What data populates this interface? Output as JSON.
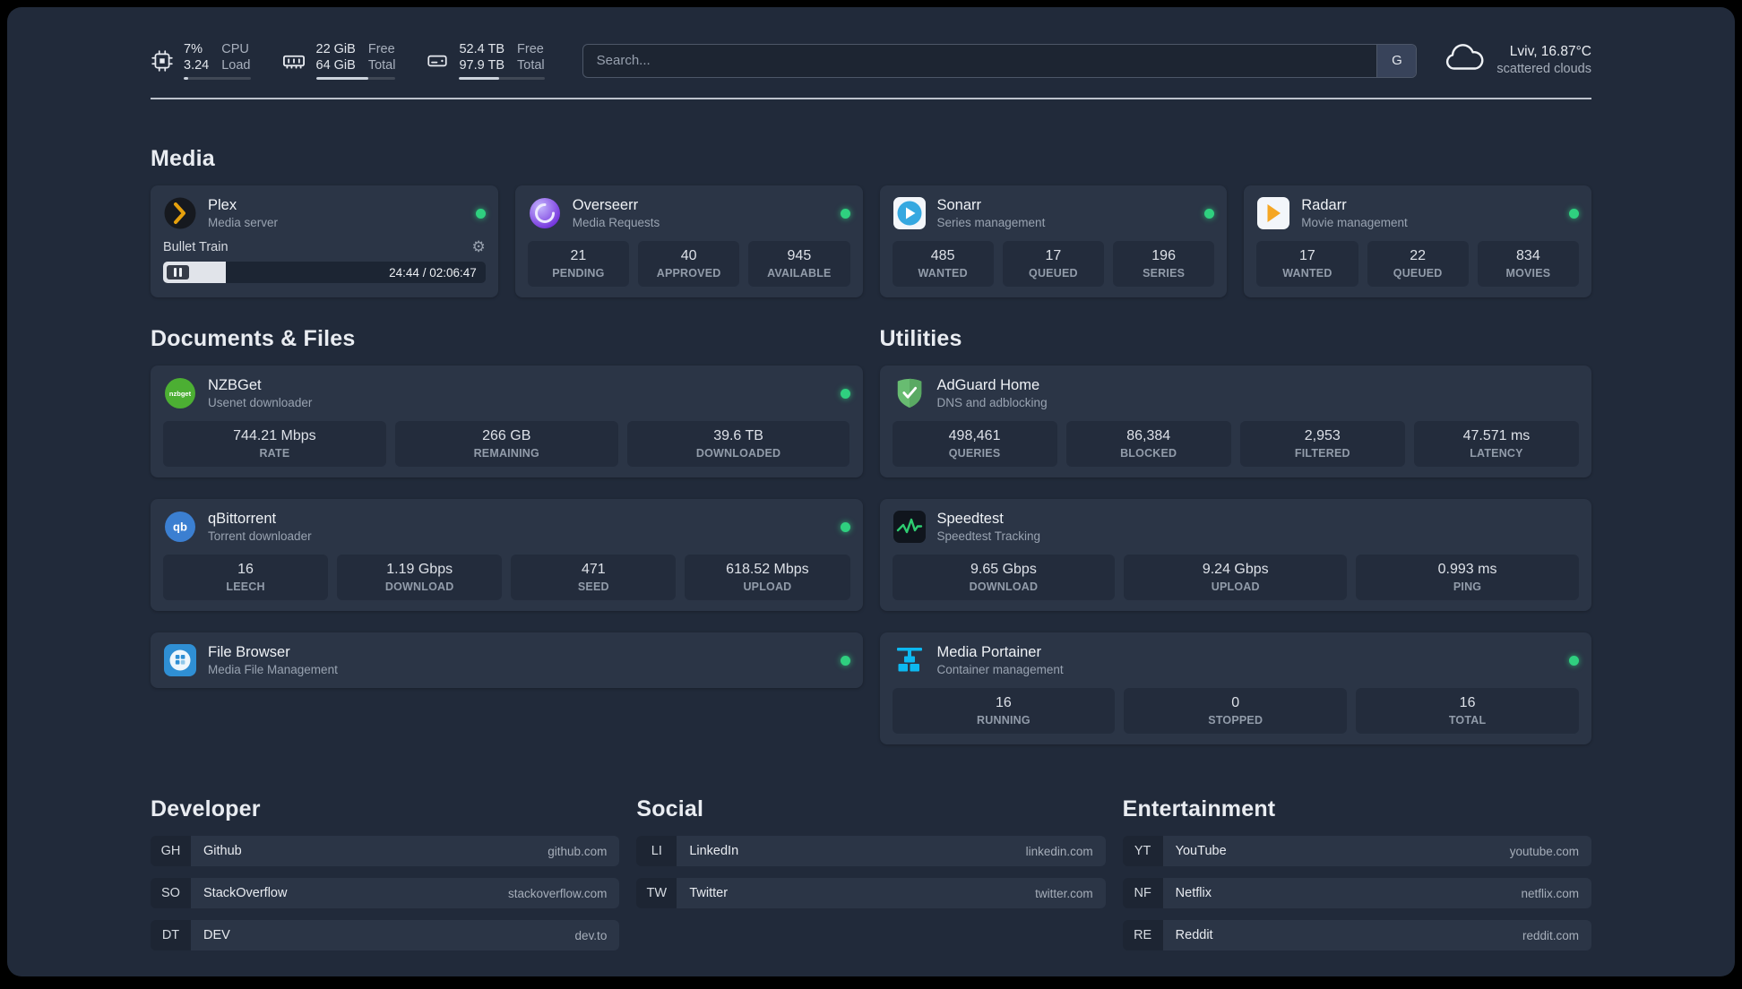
{
  "colors": {
    "status_online": "#2fd07f",
    "plex_accent": "#e5a00d",
    "overseerr_purple": "#6d28d9",
    "sonarr_blue": "#35a8e0",
    "radarr_amber": "#f5a623",
    "nzbget_green": "#4caf33",
    "qbittorrent_blue": "#3b7fd1",
    "adguard_green": "#68bc71",
    "speedtest_green": "#2ecc71",
    "portainer_blue": "#0db8f0"
  },
  "topbar": {
    "resources": [
      {
        "icon": "cpu-icon",
        "v1": "7%",
        "l1": "CPU",
        "v2": "3.24",
        "l2": "Load",
        "percent": 7
      },
      {
        "icon": "memory-icon",
        "v1": "22 GiB",
        "l1": "Free",
        "v2": "64 GiB",
        "l2": "Total",
        "percent": 66
      },
      {
        "icon": "disk-icon",
        "v1": "52.4 TB",
        "l1": "Free",
        "v2": "97.9 TB",
        "l2": "Total",
        "percent": 47
      }
    ],
    "search": {
      "placeholder": "Search...",
      "button_label": "G"
    },
    "weather": {
      "icon": "cloud-icon",
      "location": "Lviv, 16.87°C",
      "condition": "scattered clouds"
    }
  },
  "media": {
    "title": "Media",
    "cards": [
      {
        "name": "Plex",
        "subtitle": "Media server",
        "icon": "plex-icon",
        "online": true,
        "player": {
          "track": "Bullet Train",
          "time": "24:44 / 02:06:47",
          "progress_percent": 19.5
        }
      },
      {
        "name": "Overseerr",
        "subtitle": "Media Requests",
        "icon": "overseerr-icon",
        "online": true,
        "stats": [
          {
            "value": "21",
            "label": "PENDING"
          },
          {
            "value": "40",
            "label": "APPROVED"
          },
          {
            "value": "945",
            "label": "AVAILABLE"
          }
        ]
      },
      {
        "name": "Sonarr",
        "subtitle": "Series management",
        "icon": "sonarr-icon",
        "online": true,
        "stats": [
          {
            "value": "485",
            "label": "WANTED"
          },
          {
            "value": "17",
            "label": "QUEUED"
          },
          {
            "value": "196",
            "label": "SERIES"
          }
        ]
      },
      {
        "name": "Radarr",
        "subtitle": "Movie management",
        "icon": "radarr-icon",
        "online": true,
        "stats": [
          {
            "value": "17",
            "label": "WANTED"
          },
          {
            "value": "22",
            "label": "QUEUED"
          },
          {
            "value": "834",
            "label": "MOVIES"
          }
        ]
      }
    ]
  },
  "documents": {
    "title": "Documents & Files",
    "cards": [
      {
        "name": "NZBGet",
        "subtitle": "Usenet downloader",
        "icon": "nzbget-icon",
        "online": true,
        "icon_label": "nzbget",
        "stats": [
          {
            "value": "744.21 Mbps",
            "label": "RATE"
          },
          {
            "value": "266 GB",
            "label": "REMAINING"
          },
          {
            "value": "39.6 TB",
            "label": "DOWNLOADED"
          }
        ]
      },
      {
        "name": "qBittorrent",
        "subtitle": "Torrent downloader",
        "icon": "qbittorrent-icon",
        "online": true,
        "icon_label": "qb",
        "stats": [
          {
            "value": "16",
            "label": "LEECH"
          },
          {
            "value": "1.19 Gbps",
            "label": "DOWNLOAD"
          },
          {
            "value": "471",
            "label": "SEED"
          },
          {
            "value": "618.52 Mbps",
            "label": "UPLOAD"
          }
        ]
      },
      {
        "name": "File Browser",
        "subtitle": "Media File Management",
        "icon": "filebrowser-icon",
        "online": true
      }
    ]
  },
  "utilities": {
    "title": "Utilities",
    "cards": [
      {
        "name": "AdGuard Home",
        "subtitle": "DNS and adblocking",
        "icon": "adguard-icon",
        "online": false,
        "stats": [
          {
            "value": "498,461",
            "label": "QUERIES"
          },
          {
            "value": "86,384",
            "label": "BLOCKED"
          },
          {
            "value": "2,953",
            "label": "FILTERED"
          },
          {
            "value": "47.571 ms",
            "label": "LATENCY"
          }
        ]
      },
      {
        "name": "Speedtest",
        "subtitle": "Speedtest Tracking",
        "icon": "speedtest-icon",
        "online": false,
        "stats": [
          {
            "value": "9.65 Gbps",
            "label": "DOWNLOAD"
          },
          {
            "value": "9.24 Gbps",
            "label": "UPLOAD"
          },
          {
            "value": "0.993 ms",
            "label": "PING"
          }
        ]
      },
      {
        "name": "Media Portainer",
        "subtitle": "Container management",
        "icon": "portainer-icon",
        "online": true,
        "stats": [
          {
            "value": "16",
            "label": "RUNNING"
          },
          {
            "value": "0",
            "label": "STOPPED"
          },
          {
            "value": "16",
            "label": "TOTAL"
          }
        ]
      }
    ]
  },
  "bookmarks": {
    "groups": [
      {
        "title": "Developer",
        "links": [
          {
            "abbr": "GH",
            "name": "Github",
            "url": "github.com"
          },
          {
            "abbr": "SO",
            "name": "StackOverflow",
            "url": "stackoverflow.com"
          },
          {
            "abbr": "DT",
            "name": "DEV",
            "url": "dev.to"
          }
        ]
      },
      {
        "title": "Social",
        "links": [
          {
            "abbr": "LI",
            "name": "LinkedIn",
            "url": "linkedin.com"
          },
          {
            "abbr": "TW",
            "name": "Twitter",
            "url": "twitter.com"
          }
        ]
      },
      {
        "title": "Entertainment",
        "links": [
          {
            "abbr": "YT",
            "name": "YouTube",
            "url": "youtube.com"
          },
          {
            "abbr": "NF",
            "name": "Netflix",
            "url": "netflix.com"
          },
          {
            "abbr": "RE",
            "name": "Reddit",
            "url": "reddit.com"
          }
        ]
      }
    ]
  }
}
